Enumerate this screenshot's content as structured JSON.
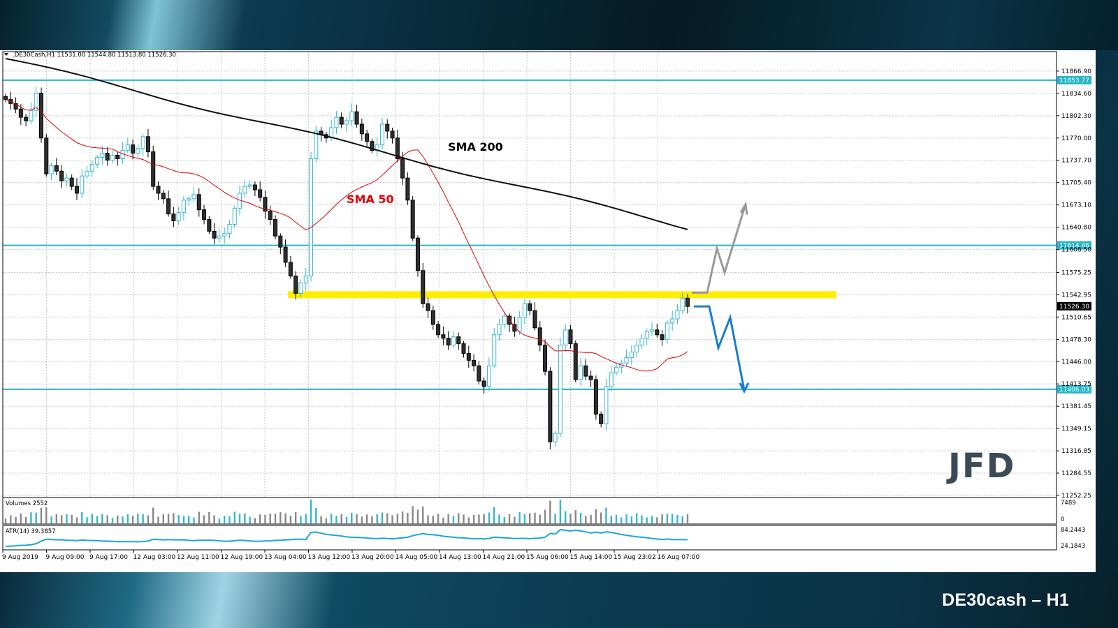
{
  "chart_data": {
    "type": "candlestick",
    "instrument_header": ".DE30Cash,H1  11531.00 11544.80 11513.80 11526.30",
    "ylim": [
      11252.25,
      11885
    ],
    "y_ticks": [
      "11866.90",
      "11834.60",
      "11802.30",
      "11770.00",
      "11737.70",
      "11705.40",
      "11673.10",
      "11640.80",
      "11608.50",
      "11575.25",
      "11542.95",
      "11510.65",
      "11478.30",
      "11446.00",
      "11413.75",
      "11381.45",
      "11349.15",
      "11316.85",
      "11284.55",
      "11252.25"
    ],
    "x_ticks": [
      "9 Aug 2019",
      "9 Aug 09:00",
      "9 Aug 17:00",
      "12 Aug 03:00",
      "12 Aug 11:00",
      "12 Aug 19:00",
      "13 Aug 04:00",
      "13 Aug 12:00",
      "13 Aug 20:00",
      "14 Aug 05:00",
      "14 Aug 13:00",
      "14 Aug 21:00",
      "15 Aug 06:00",
      "15 Aug 14:00",
      "15 Aug 23:02",
      "16 Aug 07:00"
    ],
    "levels": [
      {
        "label": "11853.77",
        "value": 11853.77,
        "color": "#26b5c9"
      },
      {
        "label": "11614.46",
        "value": 11614.46,
        "color": "#26b5c9"
      },
      {
        "label": "11406.03",
        "value": 11406.03,
        "color": "#26b5c9"
      }
    ],
    "current_price": {
      "label": "11526.30",
      "value": 11526.3
    },
    "resistance_zone": {
      "value": 11543,
      "color": "#ffee00"
    },
    "closes": [
      11826,
      11820,
      11812,
      11800,
      11795,
      11810,
      11835,
      11770,
      11718,
      11730,
      11722,
      11708,
      11712,
      11700,
      11690,
      11715,
      11722,
      11732,
      11742,
      11748,
      11738,
      11745,
      11740,
      11752,
      11760,
      11748,
      11755,
      11772,
      11750,
      11700,
      11690,
      11682,
      11660,
      11650,
      11662,
      11680,
      11682,
      11688,
      11666,
      11652,
      11635,
      11625,
      11628,
      11632,
      11645,
      11668,
      11690,
      11700,
      11702,
      11695,
      11684,
      11664,
      11652,
      11628,
      11612,
      11590,
      11570,
      11545,
      11560,
      11570,
      11740,
      11780,
      11775,
      11770,
      11785,
      11800,
      11790,
      11795,
      11808,
      11790,
      11776,
      11765,
      11752,
      11760,
      11790,
      11780,
      11770,
      11740,
      11712,
      11680,
      11625,
      11578,
      11530,
      11520,
      11500,
      11485,
      11480,
      11470,
      11482,
      11472,
      11458,
      11448,
      11440,
      11418,
      11410,
      11440,
      11485,
      11500,
      11512,
      11500,
      11490,
      11510,
      11530,
      11520,
      11495,
      11470,
      11432,
      11330,
      11342,
      11470,
      11492,
      11472,
      11420,
      11440,
      11425,
      11420,
      11370,
      11356,
      11410,
      11430,
      11438,
      11444,
      11452,
      11460,
      11470,
      11480,
      11490,
      11492,
      11485,
      11478,
      11502,
      11508,
      11520,
      11538,
      11526
    ],
    "overlay_labels": [
      {
        "text": "SMA 200",
        "color": "#000000"
      },
      {
        "text": "SMA 50",
        "color": "#e10000"
      }
    ],
    "volume_panel": {
      "label": "Volumes 2552",
      "y_ticks": [
        "7489",
        "0"
      ]
    },
    "atr_panel": {
      "label": "ATR(14) 39.3857",
      "y_ticks": [
        "84.2443",
        "24.1843"
      ]
    },
    "logo_text": "JFD"
  },
  "footer": {
    "title": "DE30cash – H1"
  }
}
